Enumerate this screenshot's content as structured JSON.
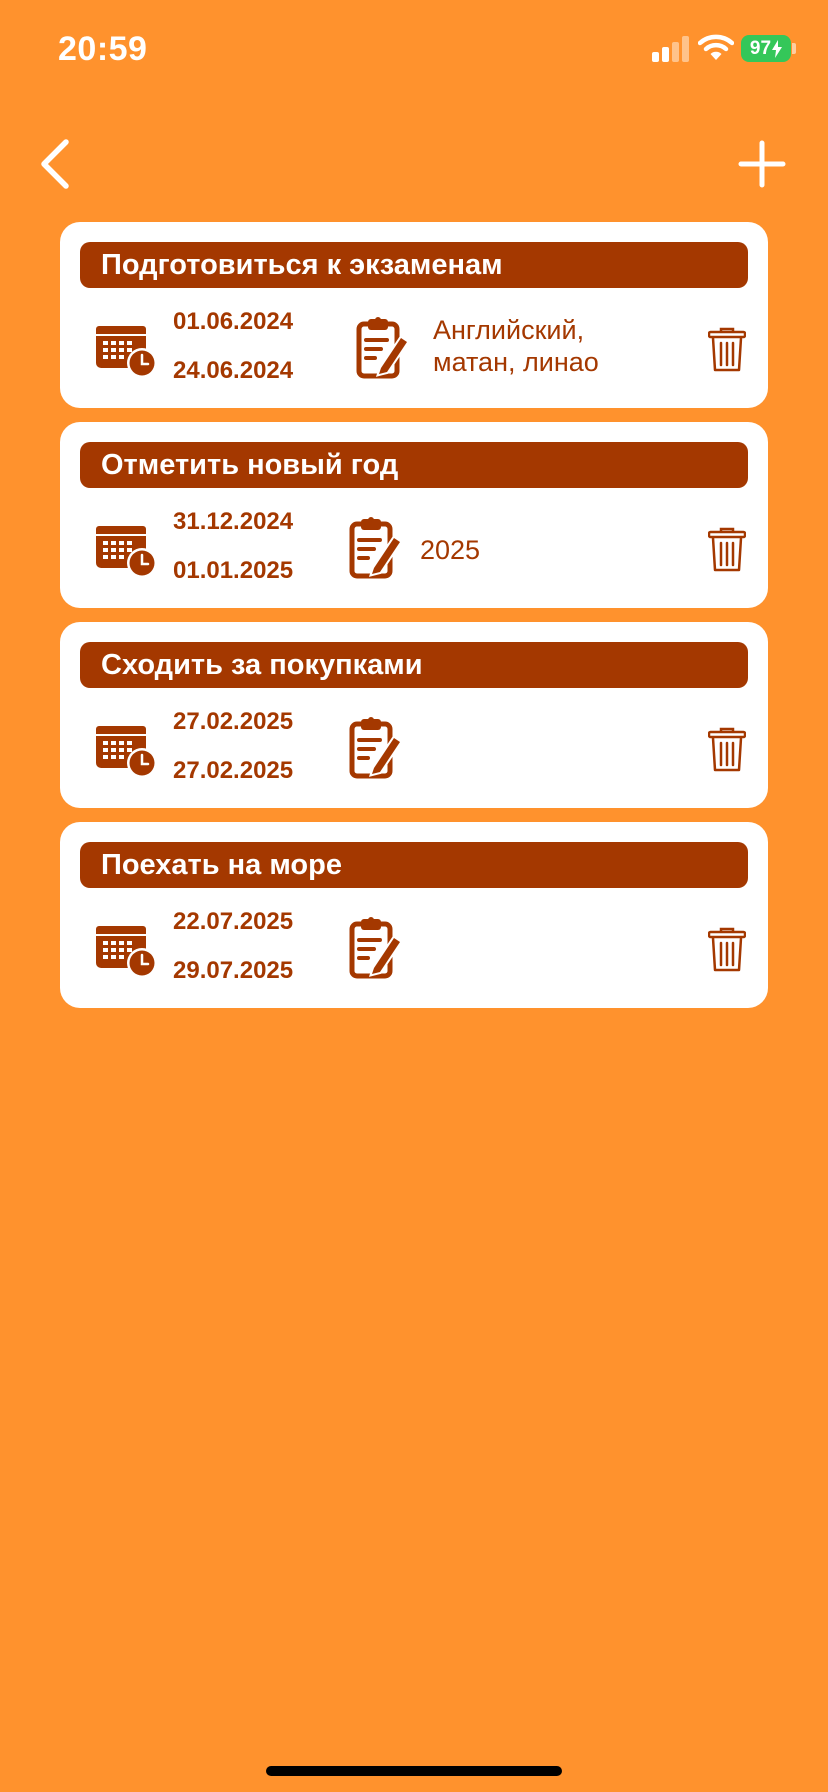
{
  "status_bar": {
    "time": "20:59",
    "battery": "97"
  },
  "nav": {
    "back_icon": "chevron-left-icon",
    "add_icon": "plus-icon"
  },
  "colors": {
    "background": "#FF922D",
    "accent": "#A43800",
    "card": "#FFFFFF"
  },
  "tasks": [
    {
      "title": "Подготовиться к экзаменам",
      "start_date": "01.06.2024",
      "end_date": "24.06.2024",
      "note_line1": "Английский,",
      "note_line2": "матан, линао"
    },
    {
      "title": "Отметить новый год",
      "start_date": "31.12.2024",
      "end_date": "01.01.2025",
      "note_line1": "2025",
      "note_line2": ""
    },
    {
      "title": "Сходить за покупками",
      "start_date": "27.02.2025",
      "end_date": "27.02.2025",
      "note_line1": "",
      "note_line2": ""
    },
    {
      "title": "Поехать на море",
      "start_date": "22.07.2025",
      "end_date": "29.07.2025",
      "note_line1": "",
      "note_line2": ""
    }
  ]
}
